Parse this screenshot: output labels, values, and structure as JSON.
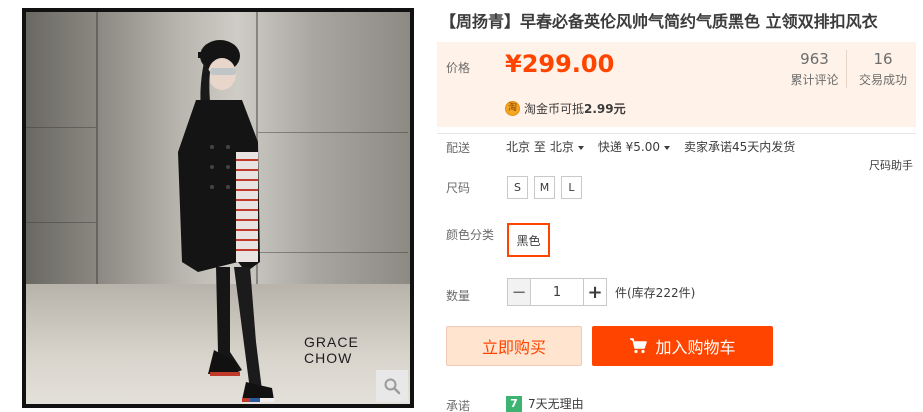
{
  "product": {
    "title": "【周扬青】早春必备英伦风帅气简约气质黑色 立领双排扣风衣",
    "image_caption": "GRACE CHOW"
  },
  "price": {
    "label": "价格",
    "currency_symbol": "¥",
    "amount": "299.00",
    "reviews_count": "963",
    "reviews_label": "累计评论",
    "deals_count": "16",
    "deals_label": "交易成功",
    "coin_icon_text": "淘",
    "coin_text_prefix": "淘金币可抵",
    "coin_value": "2.99元"
  },
  "shipping": {
    "label": "配送",
    "from": "北京 至",
    "to": "北京",
    "method": "快递 ¥5.00",
    "promise": "卖家承诺45天内发货"
  },
  "size": {
    "label": "尺码",
    "helper": "尺码助手",
    "options": [
      "S",
      "M",
      "L"
    ]
  },
  "color": {
    "label": "颜色分类",
    "selected": "黑色"
  },
  "quantity": {
    "label": "数量",
    "minus": "−",
    "value": "1",
    "plus": "+",
    "stock": "件(库存222件)"
  },
  "actions": {
    "buy_now": "立即购买",
    "add_to_cart": "加入购物车"
  },
  "service": {
    "label": "承诺",
    "badge": "7",
    "text": "7天无理由"
  },
  "colors": {
    "accent": "#ff4400",
    "price_bg": "#fff2e8",
    "buy_bg": "#ffe4d0"
  },
  "icons": {
    "zoom": "magnifier-icon",
    "cart": "cart-icon",
    "coin": "taobao-coin-icon"
  }
}
